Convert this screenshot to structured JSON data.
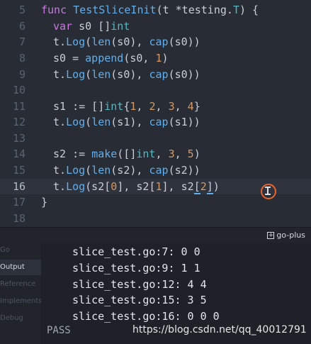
{
  "editor": {
    "active_line": "16",
    "line_numbers": [
      "5",
      "6",
      "7",
      "8",
      "9",
      "10",
      "11",
      "12",
      "13",
      "14",
      "15",
      "16",
      "17",
      "18"
    ]
  },
  "code": {
    "l5": {
      "kw": "func",
      "name": "TestSliceInit",
      "args_open": "(t *testing.",
      "type": "T",
      "args_close": ") {"
    },
    "l6": {
      "kw": "var",
      "rest": " s0 []",
      "type": "int"
    },
    "l7": {
      "a": "t.",
      "f1": "Log",
      "b": "(",
      "f2": "len",
      "c": "(s0), ",
      "f3": "cap",
      "d": "(s0))"
    },
    "l8": {
      "a": "s0 = ",
      "f1": "append",
      "b": "(s0, ",
      "n": "1",
      "c": ")"
    },
    "l9": {
      "a": "t.",
      "f1": "Log",
      "b": "(",
      "f2": "len",
      "c": "(s0), ",
      "f3": "cap",
      "d": "(s0))"
    },
    "l11": {
      "a": "s1 := []",
      "type": "int",
      "b": "{",
      "n1": "1",
      "c1": ", ",
      "n2": "2",
      "c2": ", ",
      "n3": "3",
      "c3": ", ",
      "n4": "4",
      "c4": "}"
    },
    "l12": {
      "a": "t.",
      "f1": "Log",
      "b": "(",
      "f2": "len",
      "c": "(s1), ",
      "f3": "cap",
      "d": "(s1))"
    },
    "l14": {
      "a": "s2 := ",
      "f1": "make",
      "b": "([]",
      "type": "int",
      "c": ", ",
      "n1": "3",
      "d": ", ",
      "n2": "5",
      "e": ")"
    },
    "l15": {
      "a": "t.",
      "f1": "Log",
      "b": "(",
      "f2": "len",
      "c": "(s2), ",
      "f3": "cap",
      "d": "(s2))"
    },
    "l16": {
      "a": "t.",
      "f1": "Log",
      "b": "(s2[",
      "n1": "0",
      "c": "], s2[",
      "n2": "1",
      "d": "], s2",
      "h1": "[",
      "n3": "2",
      "h2": "]",
      "e": ")"
    },
    "l17": {
      "a": "}"
    }
  },
  "panel": {
    "plugin_label": "go-plus",
    "tabs": [
      "Go",
      "Output",
      "Reference",
      "Implements",
      "Debug"
    ],
    "active_tab": "Output",
    "output_lines": [
      "slice_test.go:7: 0 0",
      "slice_test.go:9: 1 1",
      "slice_test.go:12: 4 4",
      "slice_test.go:15: 3 5",
      "slice_test.go:16: 0 0 0"
    ],
    "status": "PASS"
  },
  "watermark": "https://blog.csdn.net/qq_40012791",
  "colors": {
    "accent": "#61afef",
    "keyword": "#c678dd",
    "number": "#d19a66",
    "type": "#56b6c2",
    "cursor_ring": "#e8642a"
  }
}
